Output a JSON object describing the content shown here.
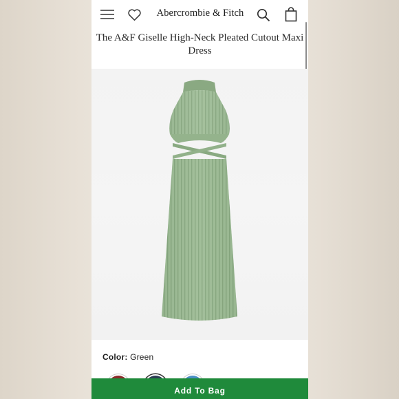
{
  "header": {
    "brand": "Abercrombie & Fitch",
    "icons": [
      "menu-icon",
      "heart-icon",
      "search-icon",
      "bag-icon"
    ]
  },
  "product": {
    "title": "The A&F Giselle High-Neck Pleated Cutout Maxi Dress",
    "color_label": "Color:",
    "color_value": "Green",
    "swatch_colors": [
      "#8c2a2a",
      "#2b3d52",
      "#4a8fc4"
    ],
    "dress_color": "#9bb894"
  },
  "actions": {
    "add_to_bag": "Add To Bag",
    "button_color": "#1f8a3b"
  }
}
